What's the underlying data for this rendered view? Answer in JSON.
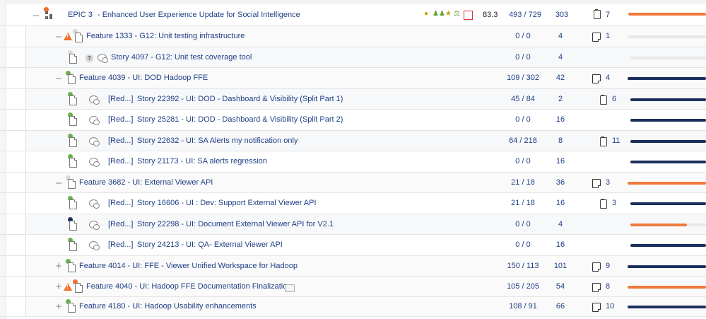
{
  "colors": {
    "link": "#1f3f86",
    "bar_navy": "#1b2f5c",
    "bar_orange": "#ef7a3b",
    "bar_grey": "#e6e6e6",
    "dot_green": "#6ab04c",
    "dot_grey": "#d8d8d8",
    "dot_navy": "#1b2f5c",
    "dot_orange": "#f0702a"
  },
  "epic": {
    "label": "EPIC 3",
    "title": "- Enhanced User Experience Update for Social Intelligence",
    "score": "83.3",
    "points": "493 / 729",
    "effort": "303",
    "notes": "7",
    "toggle": "–",
    "flag_icons": [
      "money-bag-icon",
      "people-icon",
      "handshake-icon",
      "scale-icon",
      "calendar-icon"
    ]
  },
  "rows": [
    {
      "type": "feature",
      "toggle": "–",
      "warn": true,
      "dot": "grey",
      "title": "Feature 1333 - G12: Unit testing infrastructure",
      "points": "0 / 0",
      "effort": "4",
      "note_type": "note",
      "notes": "1",
      "progress": 0,
      "bar_color": "grey"
    },
    {
      "type": "story",
      "dot": "grey",
      "question": true,
      "title": "Story 4097 - G12: Unit test coverage tool",
      "points": "0 / 0",
      "effort": "4",
      "note_type": "",
      "notes": "",
      "progress": 0,
      "bar_color": "grey"
    },
    {
      "type": "feature",
      "toggle": "–",
      "dot": "green",
      "title": "Feature 4039 - UI: DOD Hadoop FFE",
      "points": "109 / 302",
      "effort": "42",
      "note_type": "note",
      "notes": "4",
      "progress": 1,
      "bar_color": "navy"
    },
    {
      "type": "story",
      "dot": "green",
      "redacted": "[Red...]",
      "title": "Story 22392 - UI: DOD - Dashboard & Visibility (Split Part 1)",
      "points": "45 / 84",
      "effort": "2",
      "note_type": "clip",
      "notes": "6",
      "progress": 1,
      "bar_color": "navy"
    },
    {
      "type": "story",
      "dot": "green",
      "redacted": "[Red...]",
      "title": "Story 25281 - UI: DOD - Dashboard & Visibility (Split Part 2)",
      "points": "0 / 0",
      "effort": "16",
      "note_type": "",
      "notes": "",
      "progress": 1,
      "bar_color": "navy"
    },
    {
      "type": "story",
      "dot": "green",
      "redacted": "[Red...]",
      "title": "Story 22632 - UI: SA Alerts my notification only",
      "points": "64 / 218",
      "effort": "8",
      "note_type": "clip",
      "notes": "11",
      "progress": 1,
      "bar_color": "navy"
    },
    {
      "type": "story",
      "dot": "green",
      "redacted": "[Red...]",
      "title": "Story 21173 - UI: SA alerts regression",
      "points": "0 / 0",
      "effort": "16",
      "note_type": "",
      "notes": "",
      "progress": 1,
      "bar_color": "navy"
    },
    {
      "type": "feature",
      "toggle": "–",
      "dot": "grey",
      "title": "Feature 3682 - UI: External Viewer API",
      "points": "21 / 18",
      "effort": "36",
      "note_type": "note",
      "notes": "3",
      "progress": 1,
      "bar_color": "orange"
    },
    {
      "type": "story",
      "dot": "green",
      "redacted": "[Red...]",
      "title": "Story 16606 - UI : Dev: Support External Viewer API",
      "points": "21 / 18",
      "effort": "16",
      "note_type": "clip",
      "notes": "3",
      "progress": 1,
      "bar_color": "navy"
    },
    {
      "type": "story",
      "dot": "navy",
      "redacted": "[Red...]",
      "title": "Story 22298 - UI: Document External Viewer API for V2.1",
      "points": "0 / 0",
      "effort": "4",
      "note_type": "",
      "notes": "",
      "progress": 0.75,
      "bar_color": "orange"
    },
    {
      "type": "story",
      "dot": "green",
      "redacted": "[Red...]",
      "title": "Story 24213 - UI: QA- External Viewer API",
      "points": "0 / 0",
      "effort": "16",
      "note_type": "",
      "notes": "",
      "progress": 1,
      "bar_color": "navy"
    },
    {
      "type": "feature",
      "toggle": "+",
      "dot": "green",
      "title": "Feature 4014 - UI: FFE - Viewer Unified Workspace for Hadoop",
      "points": "150 / 113",
      "effort": "101",
      "note_type": "note",
      "notes": "9",
      "progress": 1,
      "bar_color": "navy"
    },
    {
      "type": "feature",
      "toggle": "+",
      "warn": true,
      "dot": "orange",
      "title": "Feature 4040 - UI: Hadoop FFE Documentation Finalization",
      "comment": true,
      "points": "105 / 205",
      "effort": "54",
      "note_type": "note",
      "notes": "8",
      "progress": 1,
      "bar_color": "orange"
    },
    {
      "type": "feature",
      "toggle": "+",
      "dot": "green",
      "title": "Feature 4180 - UI: Hadoop Usability enhancements",
      "points": "108 / 91",
      "effort": "66",
      "note_type": "note",
      "notes": "10",
      "progress": 1,
      "bar_color": "navy"
    }
  ]
}
